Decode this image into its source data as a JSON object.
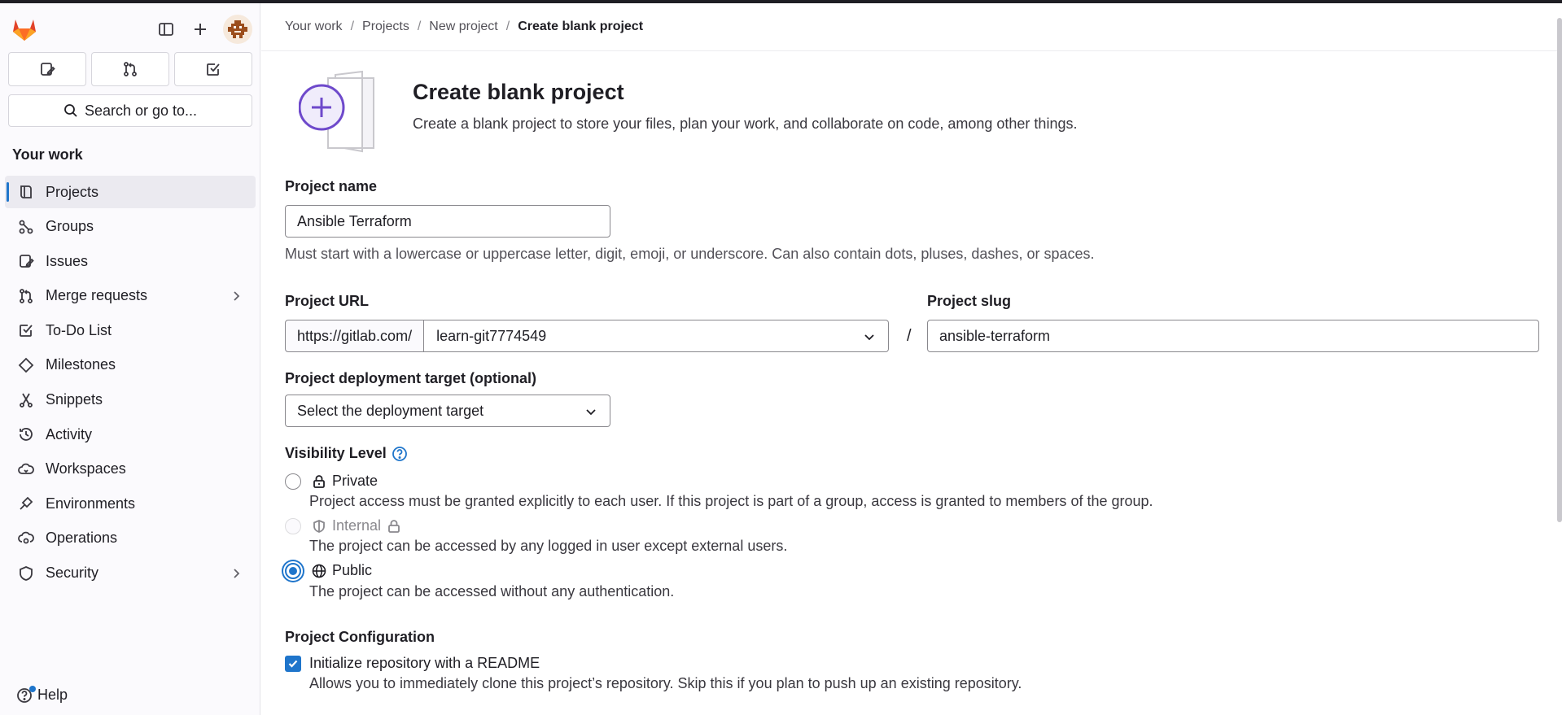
{
  "sidebar": {
    "search_label": "Search or go to...",
    "section_title": "Your work",
    "items": [
      {
        "label": "Projects",
        "icon": "project-icon",
        "active": true
      },
      {
        "label": "Groups",
        "icon": "group-icon"
      },
      {
        "label": "Issues",
        "icon": "issues-icon"
      },
      {
        "label": "Merge requests",
        "icon": "merge-request-icon",
        "expandable": true
      },
      {
        "label": "To-Do List",
        "icon": "todo-icon"
      },
      {
        "label": "Milestones",
        "icon": "milestone-icon"
      },
      {
        "label": "Snippets",
        "icon": "snippet-icon"
      },
      {
        "label": "Activity",
        "icon": "history-icon"
      },
      {
        "label": "Workspaces",
        "icon": "workspace-icon"
      },
      {
        "label": "Environments",
        "icon": "environment-icon"
      },
      {
        "label": "Operations",
        "icon": "cloud-gear-icon"
      },
      {
        "label": "Security",
        "icon": "shield-icon",
        "expandable": true
      }
    ],
    "help_label": "Help"
  },
  "breadcrumb": {
    "items": [
      "Your work",
      "Projects",
      "New project"
    ],
    "current": "Create blank project"
  },
  "hero": {
    "title": "Create blank project",
    "subtitle": "Create a blank project to store your files, plan your work, and collaborate on code, among other things."
  },
  "form": {
    "project_name_label": "Project name",
    "project_name_value": "Ansible Terraform",
    "project_name_help": "Must start with a lowercase or uppercase letter, digit, emoji, or underscore. Can also contain dots, pluses, dashes, or spaces.",
    "project_url_label": "Project URL",
    "url_prefix": "https://gitlab.com/",
    "namespace_value": "learn-git7774549",
    "slash": "/",
    "project_slug_label": "Project slug",
    "project_slug_value": "ansible-terraform",
    "deployment_label": "Project deployment target (optional)",
    "deployment_placeholder": "Select the deployment target",
    "visibility_label": "Visibility Level",
    "visibility_options": [
      {
        "label": "Private",
        "description": "Project access must be granted explicitly to each user. If this project is part of a group, access is granted to members of the group.",
        "checked": false,
        "disabled": false
      },
      {
        "label": "Internal",
        "description": "The project can be accessed by any logged in user except external users.",
        "checked": false,
        "disabled": true
      },
      {
        "label": "Public",
        "description": "The project can be accessed without any authentication.",
        "checked": true,
        "disabled": false
      }
    ],
    "config_label": "Project Configuration",
    "readme_label": "Initialize repository with a README",
    "readme_help": "Allows you to immediately clone this project’s repository. Skip this if you plan to push up an existing repository.",
    "readme_checked": true
  },
  "colors": {
    "accent": "#1f75cb",
    "illustration": "#6e49cb"
  }
}
